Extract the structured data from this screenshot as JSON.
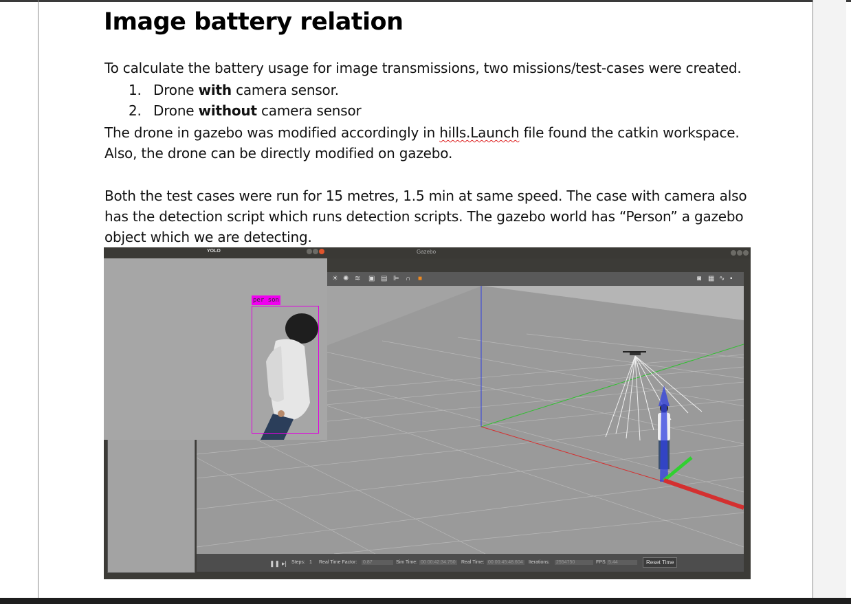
{
  "heading": "Image battery relation",
  "intro": "To calculate the battery usage for image transmissions, two missions/test-cases were created.",
  "list": [
    {
      "num": "1.",
      "pre": "Drone ",
      "bold": "with",
      "post": " camera sensor."
    },
    {
      "num": "2.",
      "pre": "Drone ",
      "bold": "without",
      "post": " camera sensor"
    }
  ],
  "para1": {
    "line1_pre": "The drone in gazebo was modified accordingly in ",
    "line1_flag": "hills.Launch",
    "line1_post": " file found the catkin workspace.",
    "line2": "Also, the drone can be directly modified on gazebo."
  },
  "para2": {
    "line1": "Both the test cases were run for 15 metres, 1.5 min at same speed. The case with camera also",
    "line2": "has the detection script which runs detection scripts. The gazebo world has “Person” a gazebo",
    "line3": "object which we are detecting."
  },
  "figure": {
    "gazebo_title": "Gazebo",
    "yolo_title": "YOLO",
    "detection_label": "per son",
    "status": {
      "steps_label": "Steps:",
      "steps_value": "1",
      "rtf_label": "Real Time Factor:",
      "rtf_value": "0.87",
      "sim_label": "Sim Time:",
      "sim_value": "00 00:42:34.750",
      "real_label": "Real Time:",
      "real_value": "00 00:45:48.604",
      "iter_label": "Iterations:",
      "iter_value": "2554750",
      "fps_label": "FPS:",
      "fps_value": "5.44",
      "reset_label": "Reset Time"
    }
  },
  "colors": {
    "detection_box": "#e000e0",
    "axis_x": "#d43030",
    "axis_y": "#30c030",
    "axis_z": "#3040e0"
  }
}
